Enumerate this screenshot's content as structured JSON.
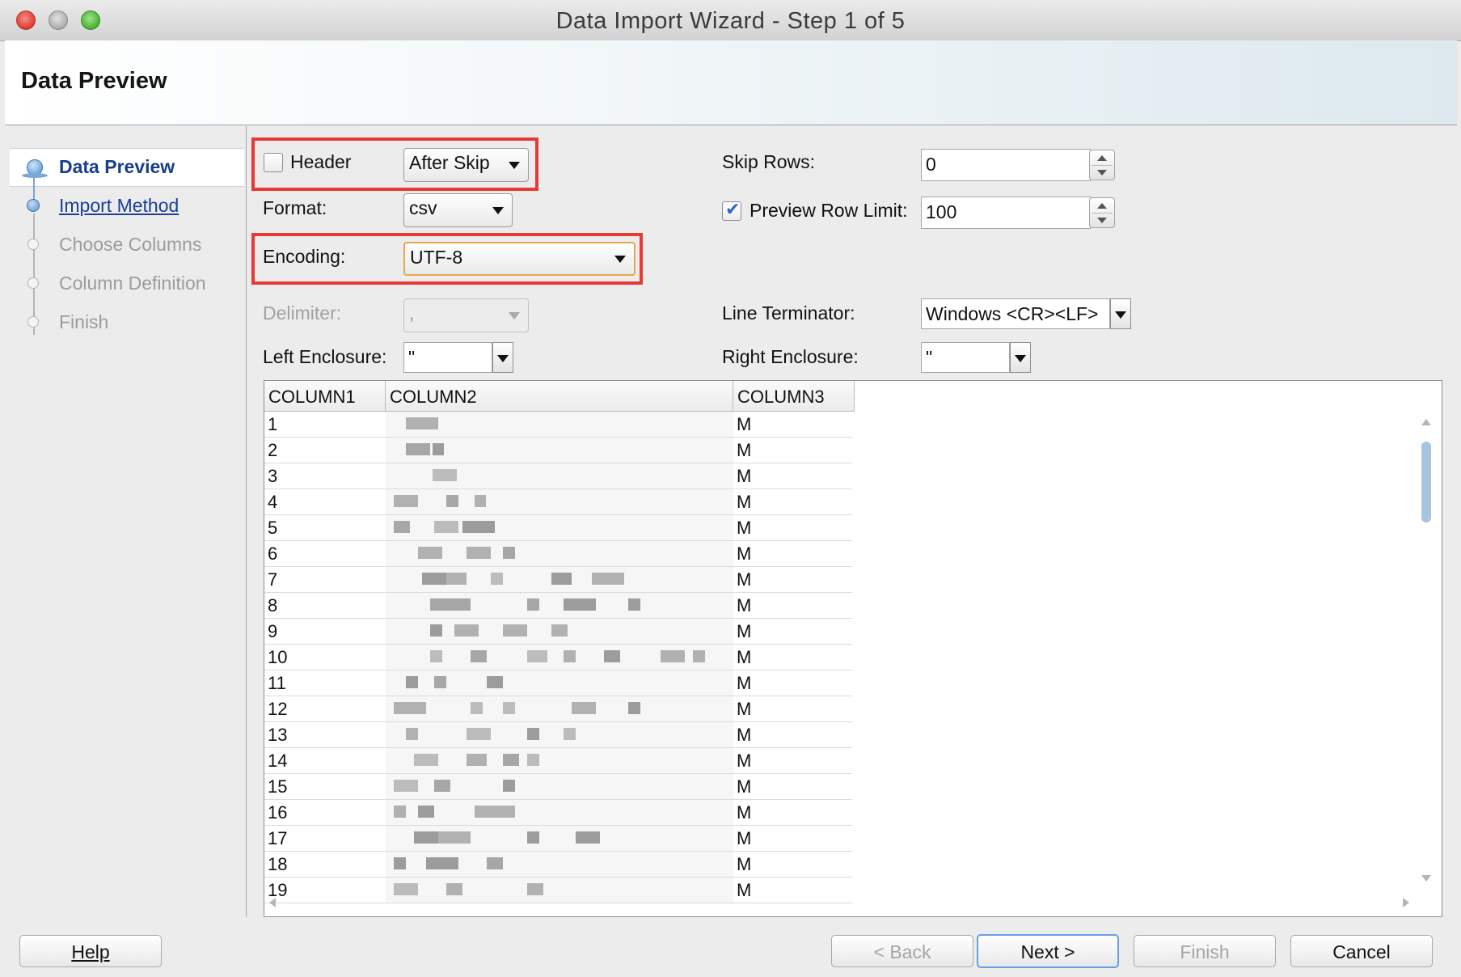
{
  "window": {
    "title": "Data Import Wizard - Step 1 of 5"
  },
  "banner": {
    "title": "Data Preview"
  },
  "nav": {
    "items": [
      {
        "label": "Data Preview",
        "state": "active"
      },
      {
        "label": "Import Method",
        "state": "link"
      },
      {
        "label": "Choose Columns",
        "state": "disabled"
      },
      {
        "label": "Column Definition",
        "state": "disabled"
      },
      {
        "label": "Finish",
        "state": "disabled"
      }
    ]
  },
  "form": {
    "header": {
      "label": "Header",
      "checked": false,
      "option": "After Skip"
    },
    "format": {
      "label": "Format:",
      "value": "csv"
    },
    "encoding": {
      "label": "Encoding:",
      "value": "UTF-8"
    },
    "delimiter": {
      "label": "Delimiter:",
      "value": ","
    },
    "left_enclosure": {
      "label": "Left Enclosure:",
      "value": "\""
    },
    "skip_rows": {
      "label": "Skip Rows:",
      "value": "0"
    },
    "preview_row_limit": {
      "label": "Preview Row Limit:",
      "value": "100",
      "checked": true
    },
    "line_terminator": {
      "label": "Line Terminator:",
      "value": "Windows <CR><LF>"
    },
    "right_enclosure": {
      "label": "Right Enclosure:",
      "value": "\""
    }
  },
  "table": {
    "columns": [
      "COLUMN1",
      "COLUMN2",
      "COLUMN3"
    ],
    "rows": [
      [
        "1",
        "",
        "M"
      ],
      [
        "2",
        "",
        "M"
      ],
      [
        "3",
        "",
        "M"
      ],
      [
        "4",
        "",
        "M"
      ],
      [
        "5",
        "",
        "M"
      ],
      [
        "6",
        "",
        "M"
      ],
      [
        "7",
        "",
        "M"
      ],
      [
        "8",
        "",
        "M"
      ],
      [
        "9",
        "",
        "M"
      ],
      [
        "10",
        "",
        "M"
      ],
      [
        "11",
        "",
        "M"
      ],
      [
        "12",
        "",
        "M"
      ],
      [
        "13",
        "",
        "M"
      ],
      [
        "14",
        "",
        "M"
      ],
      [
        "15",
        "",
        "M"
      ],
      [
        "16",
        "",
        "M"
      ],
      [
        "17",
        "",
        "M"
      ],
      [
        "18",
        "",
        "M"
      ],
      [
        "19",
        "",
        "M"
      ]
    ]
  },
  "buttons": {
    "help": "Help",
    "back": "< Back",
    "next": "Next >",
    "finish": "Finish",
    "cancel": "Cancel"
  }
}
